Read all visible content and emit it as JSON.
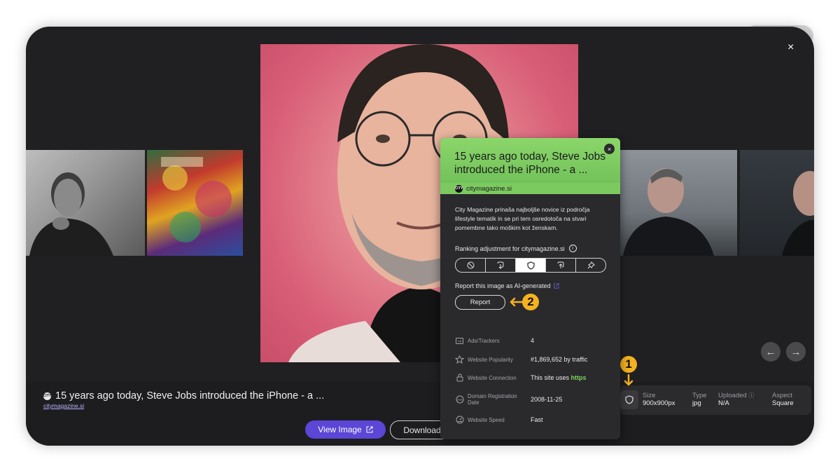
{
  "window": {
    "close_label": "×"
  },
  "popup": {
    "title": "15 years ago today, Steve Jobs introduced the iPhone - a ...",
    "close_label": "×",
    "source_favicon": "CITY",
    "source": "citymagazine.si",
    "description": "City Magazine prinaša najboljše novice iz področja lifestyle tematik in se pri tem osredotoča na stvari pomembne tako moškim kot ženskam.",
    "ranking_label": "Ranking adjustment for citymagazine.si",
    "ranking_options": [
      "block-icon",
      "lower-icon",
      "shield-icon",
      "raise-icon",
      "pin-icon"
    ],
    "ranking_selected": "shield-icon",
    "report_label": "Report this image as AI-generated",
    "report_button": "Report",
    "stats": [
      {
        "icon": "ads-icon",
        "label": "Ads/Trackers",
        "value": "4"
      },
      {
        "icon": "star-icon",
        "label": "Website Popularity",
        "value": "#1,869,652 by traffic"
      },
      {
        "icon": "lock-icon",
        "label": "Website Connection",
        "value_prefix": "This site uses ",
        "value_highlight": "https"
      },
      {
        "icon": "globe-www-icon",
        "label": "Domain Registration Date",
        "value": "2008-11-25"
      },
      {
        "icon": "speed-icon",
        "label": "Website Speed",
        "value": "Fast"
      }
    ]
  },
  "caption": {
    "favicon": "CITY",
    "title": "15 years ago today, Steve Jobs introduced the iPhone - a ...",
    "source_link": "citymagazine.si"
  },
  "actions": {
    "view_image": "View Image",
    "download": "Download"
  },
  "meta": {
    "size_label": "Size",
    "size_value": "900x900px",
    "type_label": "Type",
    "type_value": "jpg",
    "uploaded_label": "Uploaded",
    "uploaded_value": "N/A",
    "aspect_label": "Aspect",
    "aspect_value": "Square"
  },
  "nav": {
    "prev": "←",
    "next": "→"
  },
  "annotations": {
    "badge1": "1",
    "badge2": "2"
  },
  "colors": {
    "accent": "#5b46d6",
    "popup_header": "#7cc960",
    "badge": "#f5b220",
    "https": "#7cd35c"
  }
}
